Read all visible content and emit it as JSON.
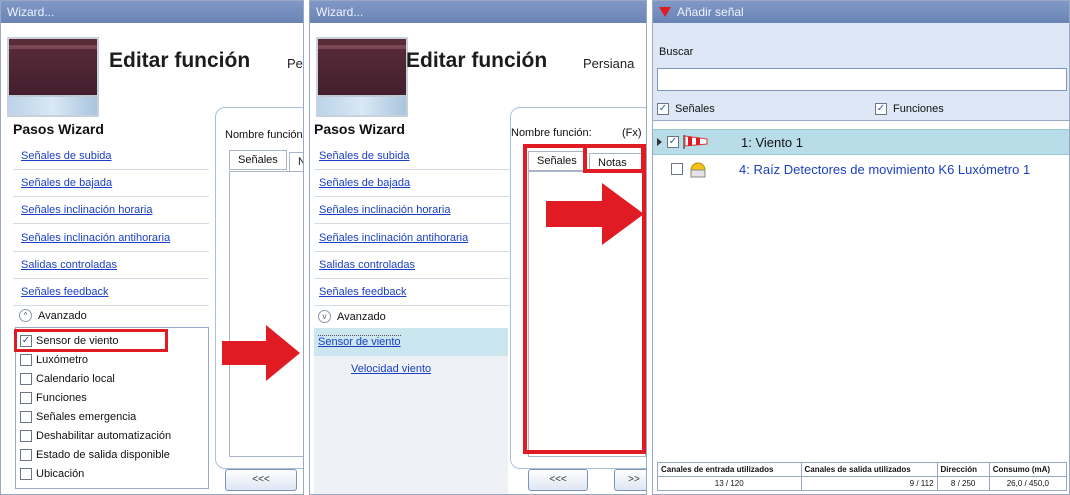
{
  "panel1": {
    "title": "Wizard...",
    "edit_title": "Editar función",
    "fname_partial": "Pe",
    "steps_title": "Pasos Wizard",
    "steps": [
      "Señales de subida",
      "Señales de bajada",
      "Señales inclinación horaria",
      "Señales inclinación antihoraria",
      "Salidas controladas",
      "Señales feedback"
    ],
    "advanced": "Avanzado",
    "options": [
      {
        "label": "Sensor de viento",
        "checked": true
      },
      {
        "label": "Luxómetro",
        "checked": false
      },
      {
        "label": "Calendario local",
        "checked": false
      },
      {
        "label": "Funciones",
        "checked": false
      },
      {
        "label": "Señales emergencia",
        "checked": false
      },
      {
        "label": "Deshabilitar automatización",
        "checked": false
      },
      {
        "label": "Estado de salida disponible",
        "checked": false
      },
      {
        "label": "Ubicación",
        "checked": false
      }
    ],
    "name_label": "Nombre función",
    "tab_signals": "Señales",
    "tab_notes_partial": "N",
    "prev_button": "<<<"
  },
  "panel2": {
    "title": "Wizard...",
    "edit_title": "Editar función",
    "fname_partial": "Persiana",
    "steps_title": "Pasos Wizard",
    "steps": [
      "Señales de subida",
      "Señales de bajada",
      "Señales inclinación horaria",
      "Señales inclinación antihoraria",
      "Salidas controladas",
      "Señales feedback"
    ],
    "advanced": "Avanzado",
    "sub_selected": "Sensor de viento",
    "sub_child": "Velocidad viento",
    "name_label": "Nombre función:",
    "name_value": "(Fx)",
    "tab_signals": "Señales",
    "tab_notes": "Notas",
    "prev_button": "<<<",
    "next_button": ">>"
  },
  "panel3": {
    "title": "Añadir señal",
    "search_label": "Buscar",
    "search_value": "",
    "filter_signals": "Señales",
    "filter_functions": "Funciones",
    "rows": [
      {
        "label": "1: Viento 1",
        "checked": true,
        "icon": "wind-sock-icon"
      },
      {
        "label": "4: Raíz Detectores de movimiento K6 Luxómetro 1",
        "checked": false,
        "icon": "lux-sensor-icon"
      }
    ],
    "stats_headers": [
      "Canales de entrada utilizados",
      "Canales de salida utilizados",
      "Dirección",
      "Consumo (mA)"
    ],
    "stats_values": [
      "13 / 120",
      "9 / 112",
      "8 / 250",
      "26,0 / 450,0"
    ]
  },
  "colors": {
    "accent_red": "#e01b24",
    "link_blue": "#1a3fc4",
    "title_bar": "#6f89b9",
    "row_highlight": "#b8dde8"
  }
}
